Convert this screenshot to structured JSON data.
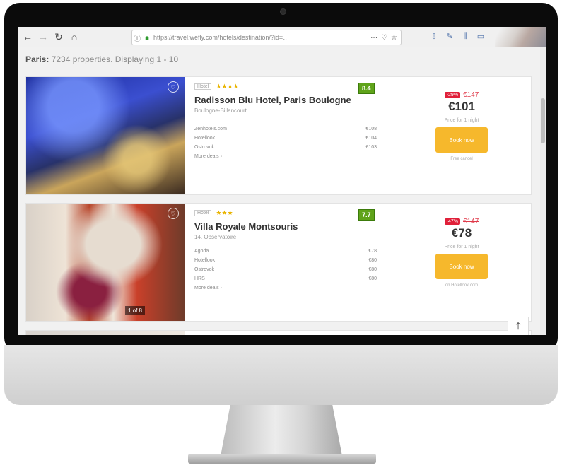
{
  "browser": {
    "url": "https://travel.wefly.com/hotels/destination/?id=…",
    "url_actions": [
      "···",
      "♡",
      "☆"
    ],
    "toolbar_icons": [
      "download-icon",
      "share-icon",
      "library-icon",
      "sidebar-icon"
    ]
  },
  "results": {
    "city": "Paris:",
    "summary": "7234 properties. Displaying 1 - 10"
  },
  "hotels": [
    {
      "type": "Hotel",
      "stars": "★★★★",
      "rating": "8.4",
      "name": "Radisson Blu Hotel, Paris Boulogne",
      "location": "Boulogne-Billancourt",
      "prices": [
        {
          "provider": "Zenhotels.com",
          "price": "€108"
        },
        {
          "provider": "Hotellook",
          "price": "€104"
        },
        {
          "provider": "Ostrovok",
          "price": "€103"
        }
      ],
      "more_deals": "More deals ›",
      "discount": "-29%",
      "old_price": "€147",
      "new_price": "€101",
      "per_night": "Price for 1 night",
      "book_label": "Book now",
      "note": "Free cancel"
    },
    {
      "type": "Hotel",
      "stars": "★★★",
      "rating": "7.7",
      "name": "Villa Royale Montsouris",
      "location": "14. Observatoire",
      "prices": [
        {
          "provider": "Agoda",
          "price": "€78"
        },
        {
          "provider": "Hotellook",
          "price": "€80"
        },
        {
          "provider": "Ostrovok",
          "price": "€80"
        },
        {
          "provider": "HRS",
          "price": "€80"
        }
      ],
      "more_deals": "More deals ›",
      "discount": "-47%",
      "old_price": "€147",
      "new_price": "€78",
      "per_night": "Price for 1 night",
      "book_label": "Book now",
      "note": "on Hotellook.com",
      "photo_label": "1 of 8"
    }
  ],
  "scroll_to_top": "⤒"
}
